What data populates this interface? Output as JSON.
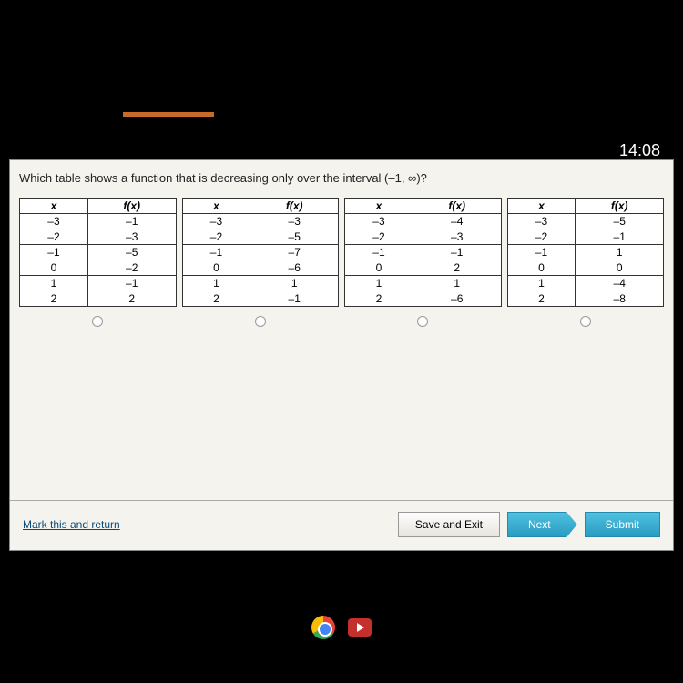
{
  "clock": "14:08",
  "question": "Which table shows a function that is decreasing only over the interval (–1, ∞)?",
  "headers": {
    "x": "x",
    "fx": "f(x)"
  },
  "chart_data": [
    {
      "type": "table",
      "x": [
        "–3",
        "–2",
        "–1",
        "0",
        "1",
        "2"
      ],
      "fx": [
        "–1",
        "–3",
        "–5",
        "–2",
        "–1",
        "2"
      ]
    },
    {
      "type": "table",
      "x": [
        "–3",
        "–2",
        "–1",
        "0",
        "1",
        "2"
      ],
      "fx": [
        "–3",
        "–5",
        "–7",
        "–6",
        "1",
        "–1"
      ]
    },
    {
      "type": "table",
      "x": [
        "–3",
        "–2",
        "–1",
        "0",
        "1",
        "2"
      ],
      "fx": [
        "–4",
        "–3",
        "–1",
        "2",
        "1",
        "–6"
      ]
    },
    {
      "type": "table",
      "x": [
        "–3",
        "–2",
        "–1",
        "0",
        "1",
        "2"
      ],
      "fx": [
        "–5",
        "–1",
        "1",
        "0",
        "–4",
        "–8"
      ]
    }
  ],
  "footer": {
    "mark": "Mark this and return",
    "save": "Save and Exit",
    "next": "Next",
    "submit": "Submit"
  }
}
